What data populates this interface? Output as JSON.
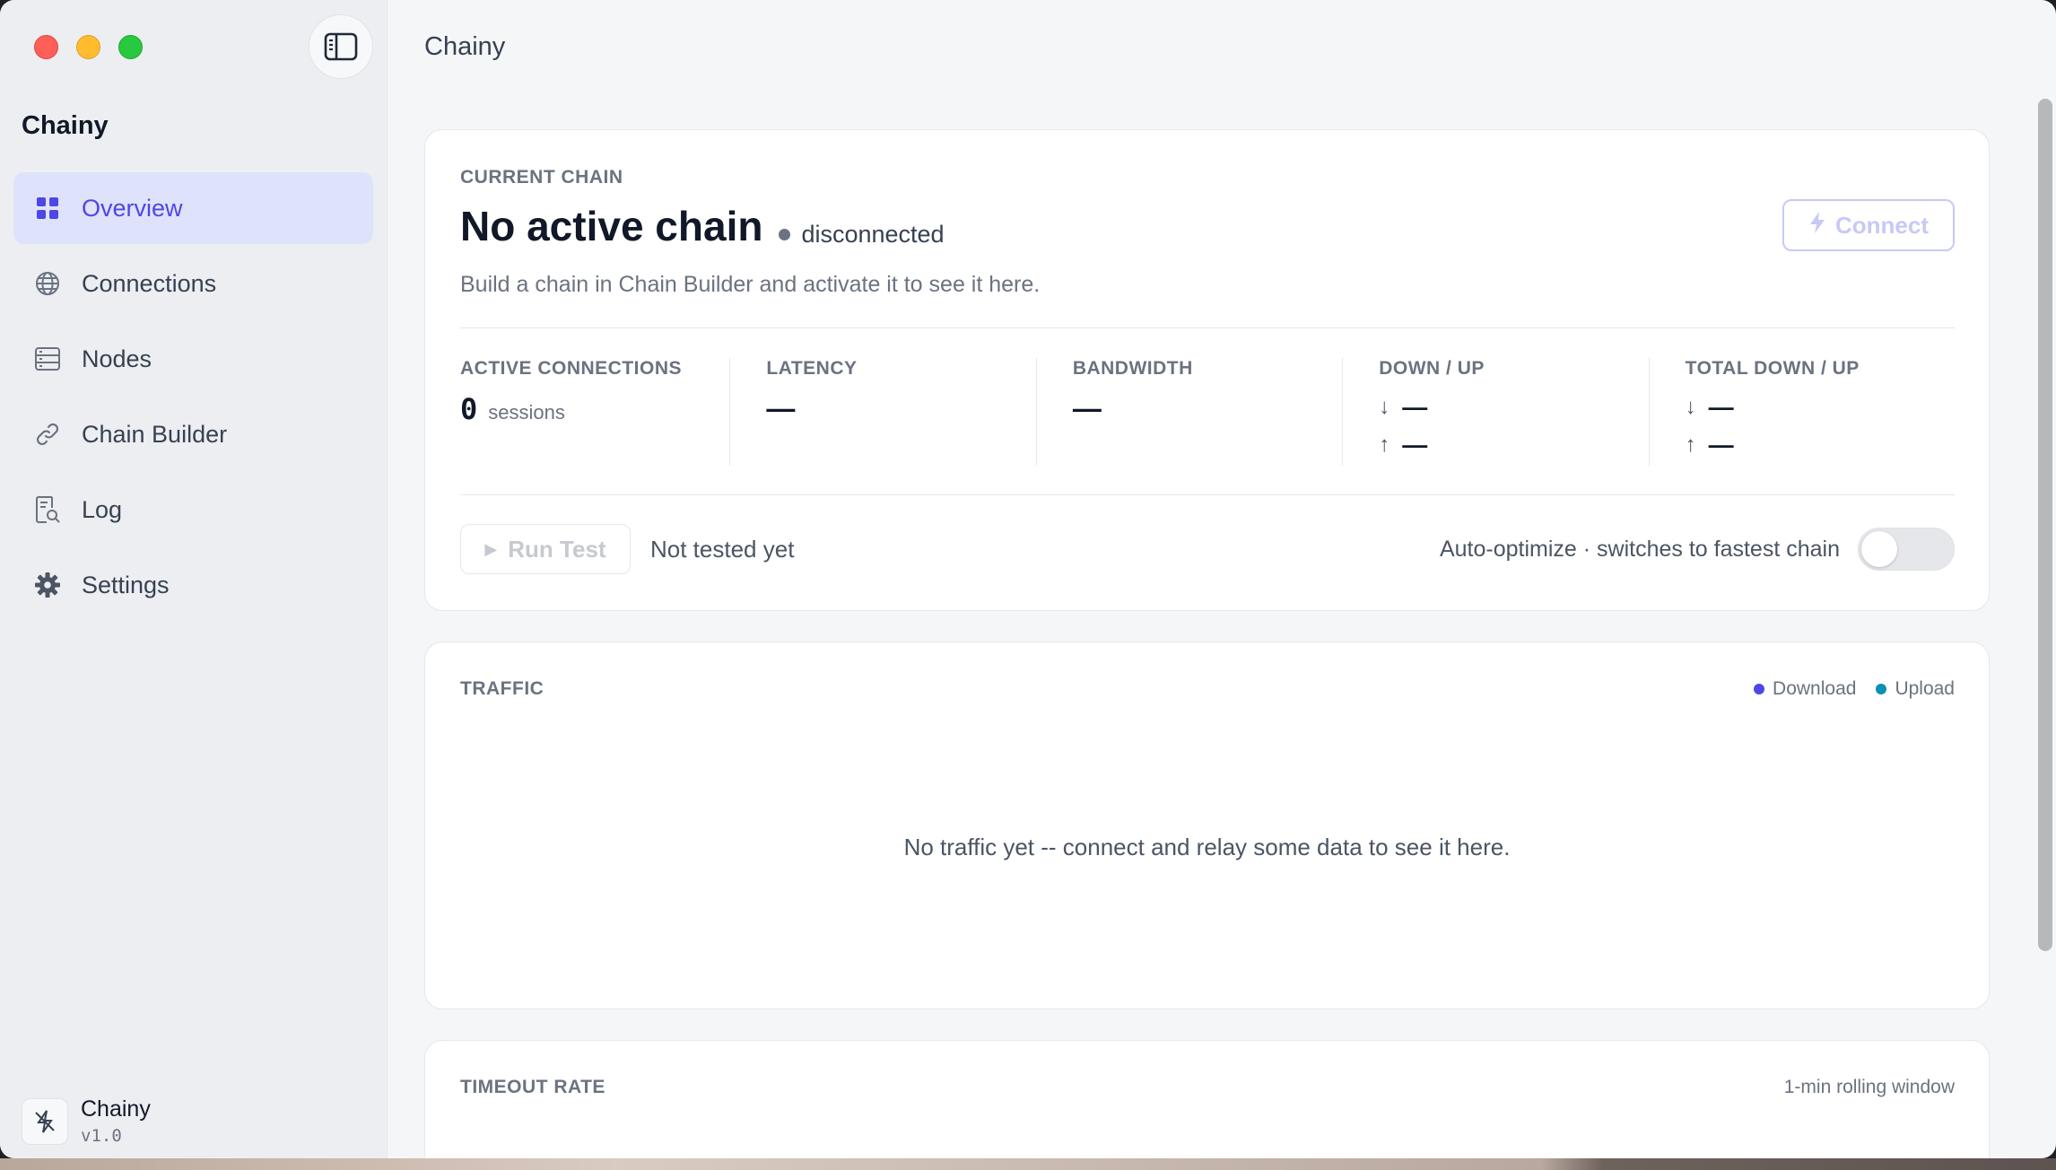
{
  "app": {
    "title": "Chainy",
    "version": "v1.0"
  },
  "sidebar": {
    "title": "Chainy",
    "items": [
      {
        "label": "Overview",
        "icon": "grid-icon",
        "active": true
      },
      {
        "label": "Connections",
        "icon": "globe-icon",
        "active": false
      },
      {
        "label": "Nodes",
        "icon": "server-icon",
        "active": false
      },
      {
        "label": "Chain Builder",
        "icon": "link-icon",
        "active": false
      },
      {
        "label": "Log",
        "icon": "document-search-icon",
        "active": false
      },
      {
        "label": "Settings",
        "icon": "gear-icon",
        "active": false
      }
    ],
    "footer": {
      "name": "Chainy",
      "version": "v1.0"
    }
  },
  "main": {
    "title": "Chainy",
    "current_chain": {
      "eyebrow": "CURRENT CHAIN",
      "name": "No active chain",
      "status": "disconnected",
      "description": "Build a chain in Chain Builder and activate it to see it here.",
      "connect_label": "Connect",
      "stats": {
        "active_connections": {
          "label": "ACTIVE CONNECTIONS",
          "value": "0",
          "unit": "sessions"
        },
        "latency": {
          "label": "LATENCY",
          "value": "—"
        },
        "bandwidth": {
          "label": "BANDWIDTH",
          "value": "—"
        },
        "down_up": {
          "label": "DOWN / UP",
          "down": "—",
          "up": "—"
        },
        "total_down_up": {
          "label": "TOTAL DOWN / UP",
          "down": "—",
          "up": "—"
        }
      },
      "run_test_label": "Run Test",
      "test_status": "Not tested yet",
      "auto_optimize_label": "Auto-optimize · switches to fastest chain",
      "auto_optimize_on": false
    },
    "traffic": {
      "title": "TRAFFIC",
      "legend": [
        {
          "label": "Download",
          "color": "#4f46e5"
        },
        {
          "label": "Upload",
          "color": "#0891b2"
        }
      ],
      "empty_message": "No traffic yet -- connect and relay some data to see it here."
    },
    "timeout_rate": {
      "title": "TIMEOUT RATE",
      "window_note": "1-min rolling window"
    }
  },
  "colors": {
    "accent": "#4f46e5",
    "active_bg": "#dee3fb"
  }
}
